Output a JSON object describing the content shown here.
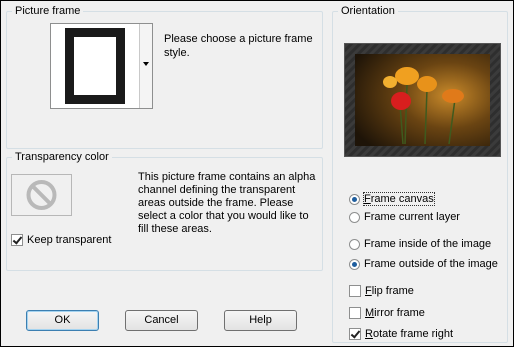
{
  "picture_frame": {
    "title": "Picture frame",
    "description": "Please choose a picture frame style."
  },
  "transparency": {
    "title": "Transparency color",
    "description": "This picture frame contains an alpha channel defining the transparent areas outside the frame.  Please select a color that you would like to fill these areas.",
    "keep_transparent_label": "Keep transparent",
    "keep_transparent_checked": true
  },
  "orientation": {
    "title": "Orientation",
    "frame_canvas": {
      "label_underlined": "F",
      "label_rest": "rame canvas",
      "checked": true
    },
    "frame_current_layer": {
      "label": "Frame current layer",
      "checked": false
    },
    "frame_inside": {
      "label": "Frame inside of the image",
      "checked": false
    },
    "frame_outside": {
      "label": "Frame outside of the image",
      "checked": true
    },
    "flip_frame": {
      "label_underlined": "F",
      "label_rest": "lip frame",
      "checked": false
    },
    "mirror_frame": {
      "label_underlined": "M",
      "label_rest": "irror frame",
      "checked": false
    },
    "rotate_frame_right": {
      "label_underlined": "R",
      "label_rest": "otate frame right",
      "checked": true
    }
  },
  "buttons": {
    "ok": "OK",
    "cancel": "Cancel",
    "help": "Help"
  }
}
